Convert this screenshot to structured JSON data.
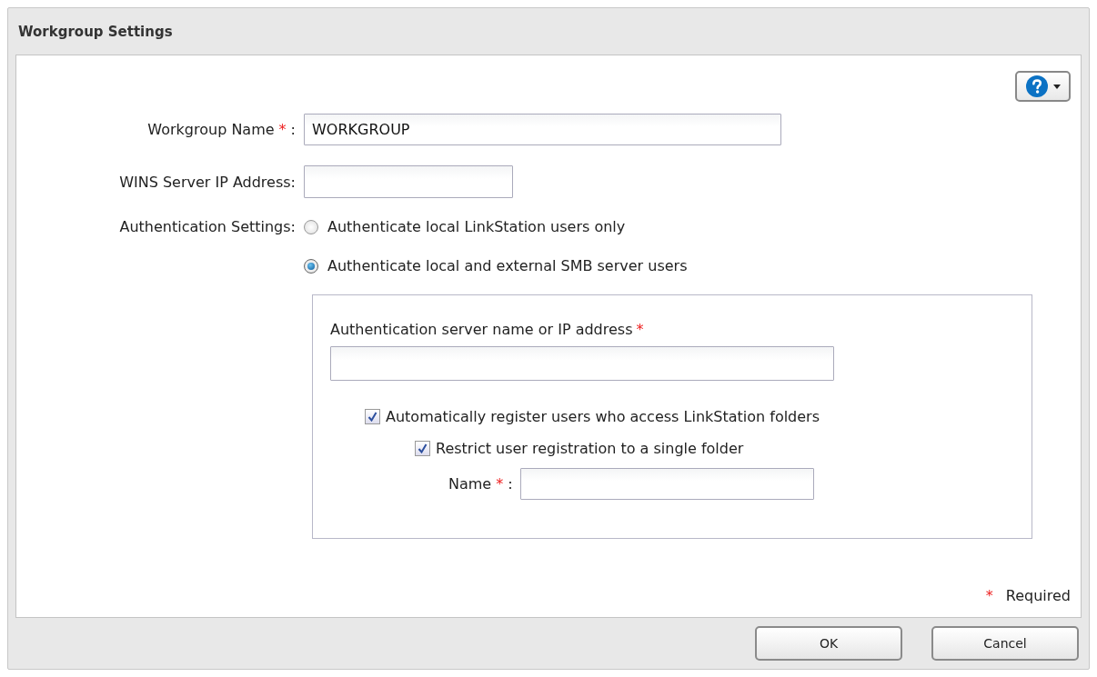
{
  "dialog": {
    "title": "Workgroup Settings"
  },
  "fields": [
    {
      "label": "Workgroup Name",
      "required_mark": "*",
      "colon": ":",
      "value": "WORKGROUP"
    },
    {
      "label": "WINS Server IP Address:"
    }
  ],
  "authentication": {
    "label": "Authentication Settings:",
    "options": [
      {
        "label": "Authenticate local LinkStation users only",
        "selected": false
      },
      {
        "label": "Authenticate local and external SMB server users",
        "selected": true
      }
    ],
    "server": {
      "label": "Authentication server name or IP address",
      "required_mark": "*"
    },
    "auto_register": {
      "label": "Automatically register users who access LinkStation folders",
      "checked": true
    },
    "restrict": {
      "label": "Restrict user registration to a single folder",
      "checked": true
    },
    "folder_name": {
      "label": "Name",
      "required_mark": "*",
      "colon": ":"
    }
  },
  "required_note": {
    "mark": "*",
    "text": "Required"
  },
  "buttons": [
    {
      "label": "OK"
    },
    {
      "label": "Cancel"
    }
  ]
}
